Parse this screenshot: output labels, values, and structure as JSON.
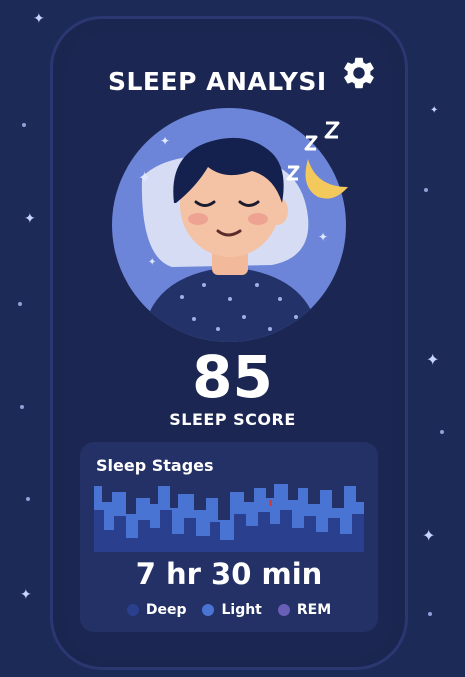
{
  "header": {
    "title": "SLEEP ANALYSI",
    "settings_icon": "gear-icon"
  },
  "score": {
    "value": "85",
    "label": "SLEEP SCORE"
  },
  "stages": {
    "title": "Sleep Stages",
    "duration": "7 hr 30 min",
    "legend": [
      {
        "label": "Deep",
        "color": "#2b3f8f"
      },
      {
        "label": "Light",
        "color": "#4a74d4"
      },
      {
        "label": "REM",
        "color": "#6a5fb6"
      }
    ]
  },
  "colors": {
    "background": "#1c2a58",
    "card": "#243167",
    "moon": "#f3c95c",
    "avatar_circle": "#6c85d8"
  }
}
